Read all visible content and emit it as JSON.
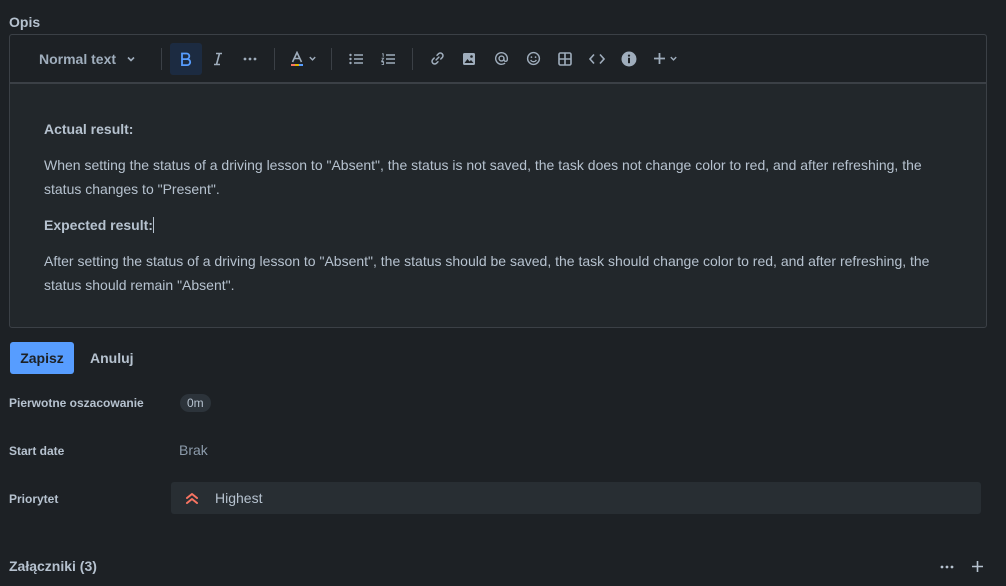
{
  "section": {
    "title": "Opis"
  },
  "toolbar": {
    "text_style": "Normal text",
    "icons": [
      "bold-icon",
      "italic-icon",
      "more-formatting-icon",
      "text-color-icon",
      "bullet-list-icon",
      "numbered-list-icon",
      "link-icon",
      "image-icon",
      "mention-icon",
      "emoji-icon",
      "table-icon",
      "code-icon",
      "info-icon",
      "insert-plus-icon"
    ]
  },
  "content": {
    "actual_heading": "Actual result:",
    "actual_text": "When setting the status of a driving lesson to \"Absent\", the status is not saved, the task does not change color to red, and after refreshing, the status changes to \"Present\".",
    "expected_heading": "Expected result:",
    "expected_text": "After setting the status of a driving lesson to \"Absent\", the status should be saved, the task should change color to red, and after refreshing, the status should remain \"Absent\"."
  },
  "actions": {
    "save": "Zapisz",
    "cancel": "Anuluj"
  },
  "fields": {
    "estimate": {
      "label": "Pierwotne oszacowanie",
      "value": "0m"
    },
    "start_date": {
      "label": "Start date",
      "value": "Brak"
    },
    "priority": {
      "label": "Priorytet",
      "value": "Highest",
      "color": "#f87462"
    }
  },
  "attachments": {
    "title": "Załączniki (3)"
  },
  "colors": {
    "accent": "#579dff",
    "background": "#1d2125"
  }
}
